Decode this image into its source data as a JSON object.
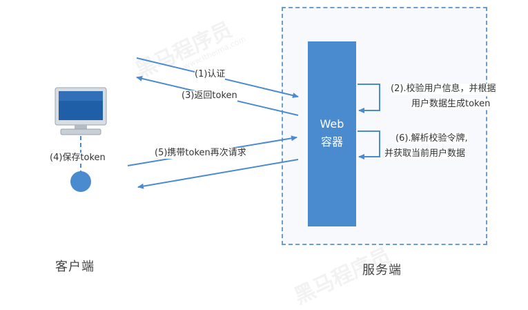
{
  "client_label": "客户端",
  "server_label": "服务端",
  "container": {
    "line1": "Web",
    "line2": "容器"
  },
  "steps": {
    "s1": "(1)认证",
    "s2_line1": "(2).校验用户信息，并根据",
    "s2_line2": "用户数据生成token",
    "s3": "(3)返回token",
    "s4": "(4)保存token",
    "s5": "(5)携带token再次请求",
    "s6_line1": "(6).解析校验令牌,",
    "s6_line2": "并获取当前用户数据"
  },
  "watermark": {
    "brand": "黑马程序员",
    "site": "www.itheima.com"
  },
  "colors": {
    "arrow": "#4a8bd0",
    "container": "#4a8bd0",
    "border": "#6b9ccc",
    "monitor_screen": "#1f5fa8"
  }
}
